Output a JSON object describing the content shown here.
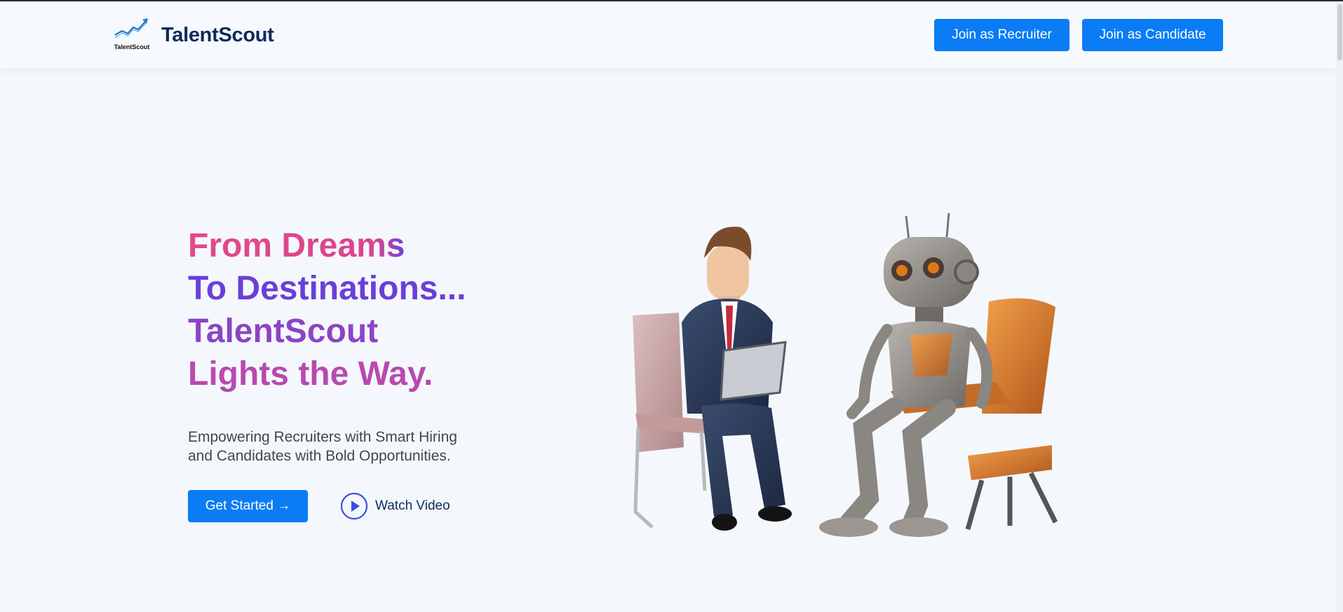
{
  "header": {
    "logo_text": "TalentScout",
    "brand": "TalentScout",
    "join_recruiter": "Join as Recruiter",
    "join_candidate": "Join as Candidate"
  },
  "hero": {
    "headline": [
      "From Dreams",
      "To Destinations...",
      "TalentScout",
      "Lights the Way."
    ],
    "subtitle_line1": "Empowering Recruiters with Smart Hiring",
    "subtitle_line2": "and Candidates with Bold Opportunities.",
    "get_started": "Get Started →",
    "watch_video": "Watch Video"
  },
  "colors": {
    "primary_button": "#0a7cf5",
    "brand_text": "#0e2a5c",
    "gradient_pink": "#e4498a",
    "gradient_purple": "#6a3fd9"
  },
  "icons": [
    "trend-chart-icon",
    "play-icon",
    "arrow-right-icon"
  ]
}
